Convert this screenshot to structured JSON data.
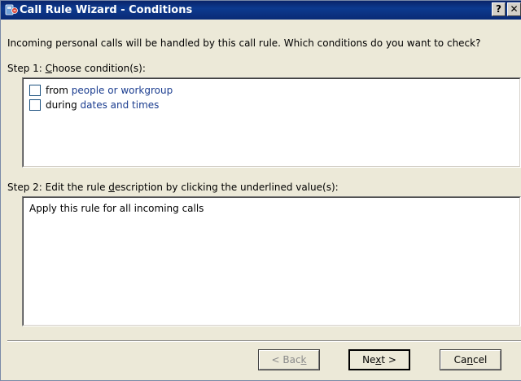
{
  "window": {
    "title": "Call Rule Wizard - Conditions",
    "help_button": "?",
    "close_button": "✕"
  },
  "intro_text": "Incoming personal calls will be handled by this call rule.  Which conditions do you want to check?",
  "step1": {
    "prefix": "Step 1: ",
    "accel": "C",
    "rest": "hoose condition(s):",
    "conditions": [
      {
        "prefix": "from ",
        "link": "people or workgroup",
        "checked": false
      },
      {
        "prefix": "during ",
        "link": "dates and times",
        "checked": false
      }
    ]
  },
  "step2": {
    "prefix": "Step 2:  Edit the rule ",
    "accel": "d",
    "rest": "escription by clicking the underlined value(s):",
    "description": "Apply this rule for all incoming calls"
  },
  "buttons": {
    "back_pre": "< Bac",
    "back_accel": "k",
    "next_pre": "Ne",
    "next_accel": "x",
    "next_post": "t >",
    "cancel_pre": "Ca",
    "cancel_accel": "n",
    "cancel_post": "cel"
  },
  "colors": {
    "titlebar": "#0a246a",
    "link": "#1a3c8f",
    "dialog_bg": "#ece9d8"
  }
}
